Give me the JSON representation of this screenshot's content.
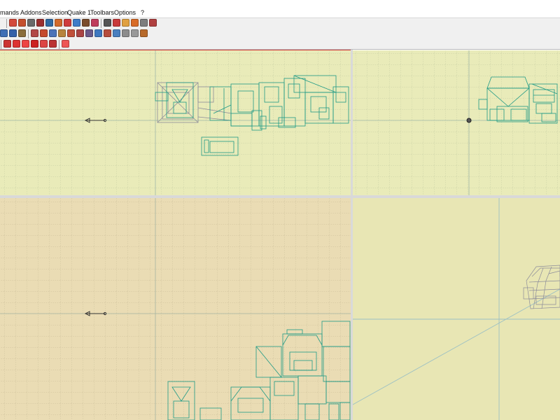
{
  "menubar": {
    "items": [
      {
        "label": "mands"
      },
      {
        "label": "Addons"
      },
      {
        "label": "Selection"
      },
      {
        "label": "Quake 1"
      },
      {
        "label": "Toolbars"
      },
      {
        "label": "Options"
      },
      {
        "label": "?"
      }
    ]
  },
  "toolbars": {
    "row1_icons": [
      "brush-icon",
      "wand-icon",
      "cube-icon",
      "sphere-icon",
      "texture-icon",
      "group-icon",
      "entity-icon",
      "prism-icon",
      "cut-icon",
      "hand-icon",
      "dice-icon",
      "box-icon",
      "arrow-point-icon",
      "pin-icon",
      "wedge-icon",
      "block-icon"
    ],
    "row2_icons": [
      "paste-icon",
      "stack-icon",
      "tile-icon",
      "nav-icon",
      "camera-icon",
      "select-icon",
      "arrow-icon",
      "home-icon",
      "faces-icon",
      "split-icon",
      "mirror-icon",
      "group2-icon",
      "bridge-icon",
      "tree-icon",
      "checkerboard-icon",
      "gear-icon"
    ],
    "row3_icons": [
      "cube-red-icon",
      "sphere-red-icon",
      "cylinder-red-icon",
      "cone-red-icon",
      "pyramid-red-icon",
      "arch-red-icon",
      "torus-red-icon"
    ]
  },
  "colors": {
    "view_top": "#e9ebb9",
    "view_bottom": "#eadcb4",
    "view_3d": "#e8e6b4",
    "grid": "#b9c39a",
    "map_lines": "#1e9a86",
    "map_grey": "#8c8c9a"
  },
  "viewports": [
    {
      "name": "top-view"
    },
    {
      "name": "side-view"
    },
    {
      "name": "front-view"
    },
    {
      "name": "3d-view"
    }
  ]
}
